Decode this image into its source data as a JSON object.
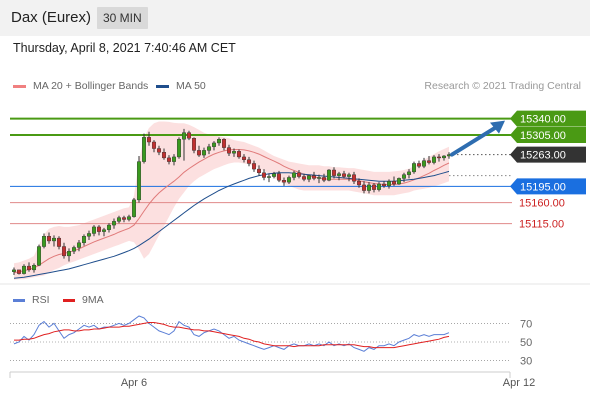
{
  "header": {
    "title": "Dax (Eurex)",
    "timeframe": "30 MIN"
  },
  "timestamp": "Thursday, April 8, 2021 7:40:46 AM CET",
  "legend": {
    "items": [
      {
        "label": "MA 20 + Bollinger Bands",
        "color": "#f08080"
      },
      {
        "label": "MA 50",
        "color": "#1f4e8c"
      }
    ],
    "credit": "Research © 2021 Trading Central"
  },
  "rsi_legend": {
    "items": [
      {
        "label": "RSI",
        "color": "#5b7fd6"
      },
      {
        "label": "9MA",
        "color": "#e02020"
      }
    ]
  },
  "chart_data": [
    {
      "type": "candlestick",
      "ylim": [
        14990,
        15380
      ],
      "levels": [
        {
          "value": 15340.0,
          "label": "15340.00",
          "style": "resistance",
          "color": "#4a9a14"
        },
        {
          "value": 15305.0,
          "label": "15305.00",
          "style": "resistance",
          "color": "#4a9a14"
        },
        {
          "value": 15263.0,
          "label": "15263.00",
          "style": "last",
          "color": "#333333"
        },
        {
          "value": 15195.0,
          "label": "15195.00",
          "style": "pivot",
          "color": "#1a6fe0"
        },
        {
          "value": 15160.0,
          "label": "15160.00",
          "style": "support",
          "color": "#cc2222"
        },
        {
          "value": 15115.0,
          "label": "15115.00",
          "style": "support",
          "color": "#cc2222"
        }
      ],
      "candles": [
        [
          15012,
          15021,
          15005,
          15016
        ],
        [
          15016,
          15016,
          15006,
          15008
        ],
        [
          15008,
          15028,
          15006,
          15024
        ],
        [
          15024,
          15032,
          15012,
          15016
        ],
        [
          15016,
          15030,
          15010,
          15026
        ],
        [
          15026,
          15070,
          15024,
          15066
        ],
        [
          15066,
          15094,
          15062,
          15088
        ],
        [
          15088,
          15096,
          15072,
          15078
        ],
        [
          15078,
          15090,
          15066,
          15084
        ],
        [
          15084,
          15088,
          15060,
          15066
        ],
        [
          15066,
          15074,
          15040,
          15046
        ],
        [
          15046,
          15062,
          15034,
          15056
        ],
        [
          15056,
          15068,
          15050,
          15064
        ],
        [
          15064,
          15080,
          15056,
          15074
        ],
        [
          15074,
          15092,
          15068,
          15088
        ],
        [
          15088,
          15100,
          15080,
          15094
        ],
        [
          15094,
          15112,
          15088,
          15108
        ],
        [
          15108,
          15112,
          15090,
          15098
        ],
        [
          15098,
          15106,
          15088,
          15102
        ],
        [
          15102,
          15116,
          15096,
          15112
        ],
        [
          15112,
          15126,
          15104,
          15120
        ],
        [
          15120,
          15132,
          15116,
          15128
        ],
        [
          15128,
          15132,
          15118,
          15124
        ],
        [
          15124,
          15134,
          15120,
          15130
        ],
        [
          15130,
          15170,
          15128,
          15166
        ],
        [
          15166,
          15260,
          15160,
          15248
        ],
        [
          15248,
          15308,
          15244,
          15300
        ],
        [
          15300,
          15312,
          15282,
          15290
        ],
        [
          15290,
          15294,
          15268,
          15276
        ],
        [
          15276,
          15282,
          15262,
          15268
        ],
        [
          15268,
          15276,
          15252,
          15256
        ],
        [
          15256,
          15262,
          15242,
          15248
        ],
        [
          15248,
          15264,
          15240,
          15258
        ],
        [
          15258,
          15300,
          15254,
          15296
        ],
        [
          15296,
          15318,
          15250,
          15310
        ],
        [
          15310,
          15314,
          15294,
          15298
        ],
        [
          15298,
          15300,
          15266,
          15272
        ],
        [
          15272,
          15282,
          15258,
          15262
        ],
        [
          15262,
          15278,
          15256,
          15272
        ],
        [
          15272,
          15286,
          15264,
          15280
        ],
        [
          15280,
          15292,
          15272,
          15288
        ],
        [
          15288,
          15300,
          15282,
          15296
        ],
        [
          15296,
          15298,
          15272,
          15278
        ],
        [
          15278,
          15284,
          15260,
          15266
        ],
        [
          15266,
          15276,
          15258,
          15270
        ],
        [
          15270,
          15274,
          15254,
          15258
        ],
        [
          15258,
          15264,
          15246,
          15252
        ],
        [
          15252,
          15258,
          15238,
          15244
        ],
        [
          15244,
          15250,
          15226,
          15232
        ],
        [
          15232,
          15240,
          15218,
          15224
        ],
        [
          15224,
          15232,
          15208,
          15214
        ],
        [
          15214,
          15222,
          15204,
          15216
        ],
        [
          15216,
          15226,
          15212,
          15222
        ],
        [
          15222,
          15228,
          15204,
          15208
        ],
        [
          15208,
          15214,
          15196,
          15204
        ],
        [
          15204,
          15218,
          15200,
          15214
        ],
        [
          15214,
          15228,
          15208,
          15224
        ],
        [
          15224,
          15230,
          15212,
          15216
        ],
        [
          15216,
          15222,
          15206,
          15210
        ],
        [
          15210,
          15220,
          15204,
          15218
        ],
        [
          15218,
          15226,
          15208,
          15212
        ],
        [
          15212,
          15220,
          15202,
          15214
        ],
        [
          15214,
          15222,
          15204,
          15208
        ],
        [
          15208,
          15232,
          15206,
          15230
        ],
        [
          15230,
          15236,
          15212,
          15218
        ],
        [
          15218,
          15226,
          15208,
          15222
        ],
        [
          15222,
          15228,
          15212,
          15216
        ],
        [
          15216,
          15224,
          15206,
          15220
        ],
        [
          15220,
          15226,
          15200,
          15206
        ],
        [
          15206,
          15212,
          15192,
          15198
        ],
        [
          15198,
          15206,
          15180,
          15186
        ],
        [
          15186,
          15204,
          15180,
          15198
        ],
        [
          15198,
          15202,
          15182,
          15188
        ],
        [
          15188,
          15204,
          15184,
          15200
        ],
        [
          15200,
          15206,
          15192,
          15196
        ],
        [
          15196,
          15210,
          15190,
          15206
        ],
        [
          15206,
          15216,
          15196,
          15200
        ],
        [
          15200,
          15214,
          15198,
          15212
        ],
        [
          15212,
          15224,
          15204,
          15220
        ],
        [
          15220,
          15232,
          15212,
          15226
        ],
        [
          15226,
          15248,
          15222,
          15244
        ],
        [
          15244,
          15250,
          15234,
          15238
        ],
        [
          15238,
          15256,
          15234,
          15250
        ],
        [
          15250,
          15260,
          15242,
          15246
        ],
        [
          15246,
          15262,
          15242,
          15258
        ],
        [
          15258,
          15264,
          15248,
          15256
        ],
        [
          15256,
          15262,
          15250,
          15260
        ],
        [
          15260,
          15268,
          15254,
          15263
        ]
      ],
      "ma20": [
        15010,
        15012,
        15014,
        15017,
        15020,
        15026,
        15033,
        15040,
        15045,
        15049,
        15051,
        15054,
        15057,
        15061,
        15066,
        15071,
        15076,
        15080,
        15084,
        15088,
        15092,
        15097,
        15101,
        15105,
        15112,
        15126,
        15142,
        15157,
        15170,
        15181,
        15190,
        15198,
        15206,
        15215,
        15225,
        15233,
        15240,
        15247,
        15253,
        15259,
        15264,
        15268,
        15271,
        15273,
        15274,
        15274,
        15273,
        15271,
        15268,
        15264,
        15259,
        15254,
        15249,
        15244,
        15238,
        15233,
        15229,
        15225,
        15221,
        15218,
        15215,
        15213,
        15211,
        15210,
        15210,
        15210,
        15210,
        15210,
        15209,
        15207,
        15205,
        15203,
        15201,
        15200,
        15199,
        15199,
        15199,
        15200,
        15202,
        15205,
        15209,
        15213,
        15218,
        15223,
        15229,
        15234,
        15240,
        15245
      ],
      "bb_upper": [
        15030,
        15032,
        15036,
        15040,
        15046,
        15070,
        15092,
        15104,
        15108,
        15110,
        15108,
        15108,
        15110,
        15112,
        15116,
        15120,
        15124,
        15128,
        15132,
        15136,
        15140,
        15144,
        15148,
        15150,
        15175,
        15250,
        15300,
        15320,
        15330,
        15334,
        15334,
        15333,
        15331,
        15330,
        15330,
        15327,
        15322,
        15316,
        15310,
        15306,
        15304,
        15302,
        15300,
        15298,
        15294,
        15292,
        15290,
        15286,
        15282,
        15278,
        15272,
        15266,
        15260,
        15256,
        15252,
        15248,
        15246,
        15244,
        15242,
        15240,
        15240,
        15240,
        15238,
        15238,
        15236,
        15236,
        15235,
        15234,
        15234,
        15232,
        15230,
        15228,
        15226,
        15226,
        15226,
        15226,
        15227,
        15228,
        15230,
        15233,
        15238,
        15244,
        15252,
        15258,
        15264,
        15270,
        15275,
        15280
      ],
      "bb_lower": [
        14995,
        14996,
        14996,
        14998,
        15000,
        15002,
        15004,
        15010,
        15016,
        15020,
        15026,
        15030,
        15034,
        15038,
        15042,
        15046,
        15050,
        15054,
        15058,
        15062,
        15066,
        15070,
        15074,
        15078,
        15075,
        15060,
        15040,
        15050,
        15070,
        15090,
        15110,
        15130,
        15150,
        15168,
        15182,
        15196,
        15206,
        15214,
        15220,
        15226,
        15232,
        15236,
        15240,
        15244,
        15246,
        15246,
        15244,
        15242,
        15238,
        15234,
        15228,
        15222,
        15214,
        15206,
        15200,
        15196,
        15192,
        15188,
        15186,
        15186,
        15186,
        15186,
        15186,
        15186,
        15186,
        15186,
        15186,
        15186,
        15184,
        15182,
        15180,
        15178,
        15176,
        15176,
        15176,
        15176,
        15176,
        15178,
        15180,
        15182,
        15186,
        15188,
        15190,
        15192,
        15195,
        15198,
        15202,
        15206
      ],
      "ma50": [
        14998,
        14999,
        15000,
        15002,
        15004,
        15006,
        15008,
        15010,
        15012,
        15014,
        15016,
        15018,
        15021,
        15024,
        15027,
        15030,
        15033,
        15036,
        15039,
        15042,
        15045,
        15049,
        15053,
        15057,
        15062,
        15068,
        15075,
        15082,
        15090,
        15098,
        15106,
        15114,
        15122,
        15130,
        15138,
        15146,
        15154,
        15161,
        15168,
        15174,
        15180,
        15186,
        15191,
        15196,
        15200,
        15204,
        15208,
        15212,
        15215,
        15218,
        15220,
        15222,
        15223,
        15224,
        15224,
        15224,
        15223,
        15222,
        15221,
        15220,
        15219,
        15218,
        15217,
        15216,
        15215,
        15214,
        15213,
        15212,
        15211,
        15210,
        15209,
        15208,
        15207,
        15206,
        15206,
        15206,
        15206,
        15207,
        15208,
        15209,
        15210,
        15212,
        15214,
        15216,
        15218,
        15221,
        15224,
        15227
      ],
      "forecast_arrow": {
        "from": 15263,
        "to": 15340
      },
      "x_ticks": [
        {
          "label": "Apr 6",
          "index": 24
        },
        {
          "label": "Apr 12",
          "index": 101
        }
      ]
    },
    {
      "type": "line",
      "name": "RSI",
      "ylim": [
        22,
        78
      ],
      "y_ticks": [
        70,
        50,
        30
      ],
      "rsi": [
        48,
        50,
        56,
        52,
        58,
        68,
        72,
        66,
        70,
        62,
        54,
        58,
        60,
        64,
        68,
        66,
        68,
        64,
        66,
        66,
        68,
        70,
        68,
        70,
        74,
        78,
        76,
        70,
        66,
        62,
        60,
        58,
        62,
        72,
        68,
        66,
        58,
        56,
        60,
        62,
        64,
        62,
        58,
        54,
        56,
        52,
        50,
        48,
        46,
        44,
        42,
        44,
        46,
        44,
        42,
        46,
        48,
        46,
        46,
        48,
        46,
        48,
        46,
        50,
        46,
        48,
        46,
        48,
        44,
        42,
        40,
        44,
        42,
        46,
        46,
        48,
        46,
        50,
        52,
        54,
        58,
        56,
        58,
        56,
        58,
        58,
        58,
        60
      ],
      "rsi_ma": [
        52,
        52,
        53,
        53,
        54,
        56,
        58,
        59,
        61,
        62,
        63,
        63,
        62,
        62,
        63,
        63,
        64,
        64,
        65,
        66,
        66,
        66,
        67,
        67,
        68,
        69,
        70,
        71,
        71,
        70,
        69,
        67,
        66,
        66,
        65,
        64,
        63,
        63,
        62,
        62,
        61,
        60,
        59,
        58,
        57,
        56,
        54,
        53,
        51,
        50,
        48,
        47,
        46,
        46,
        46,
        46,
        45,
        46,
        46,
        46,
        46,
        46,
        47,
        47,
        47,
        47,
        47,
        47,
        47,
        46,
        45,
        45,
        44,
        44,
        44,
        44,
        44,
        45,
        46,
        47,
        48,
        49,
        50,
        51,
        52,
        53,
        55,
        56
      ]
    }
  ]
}
